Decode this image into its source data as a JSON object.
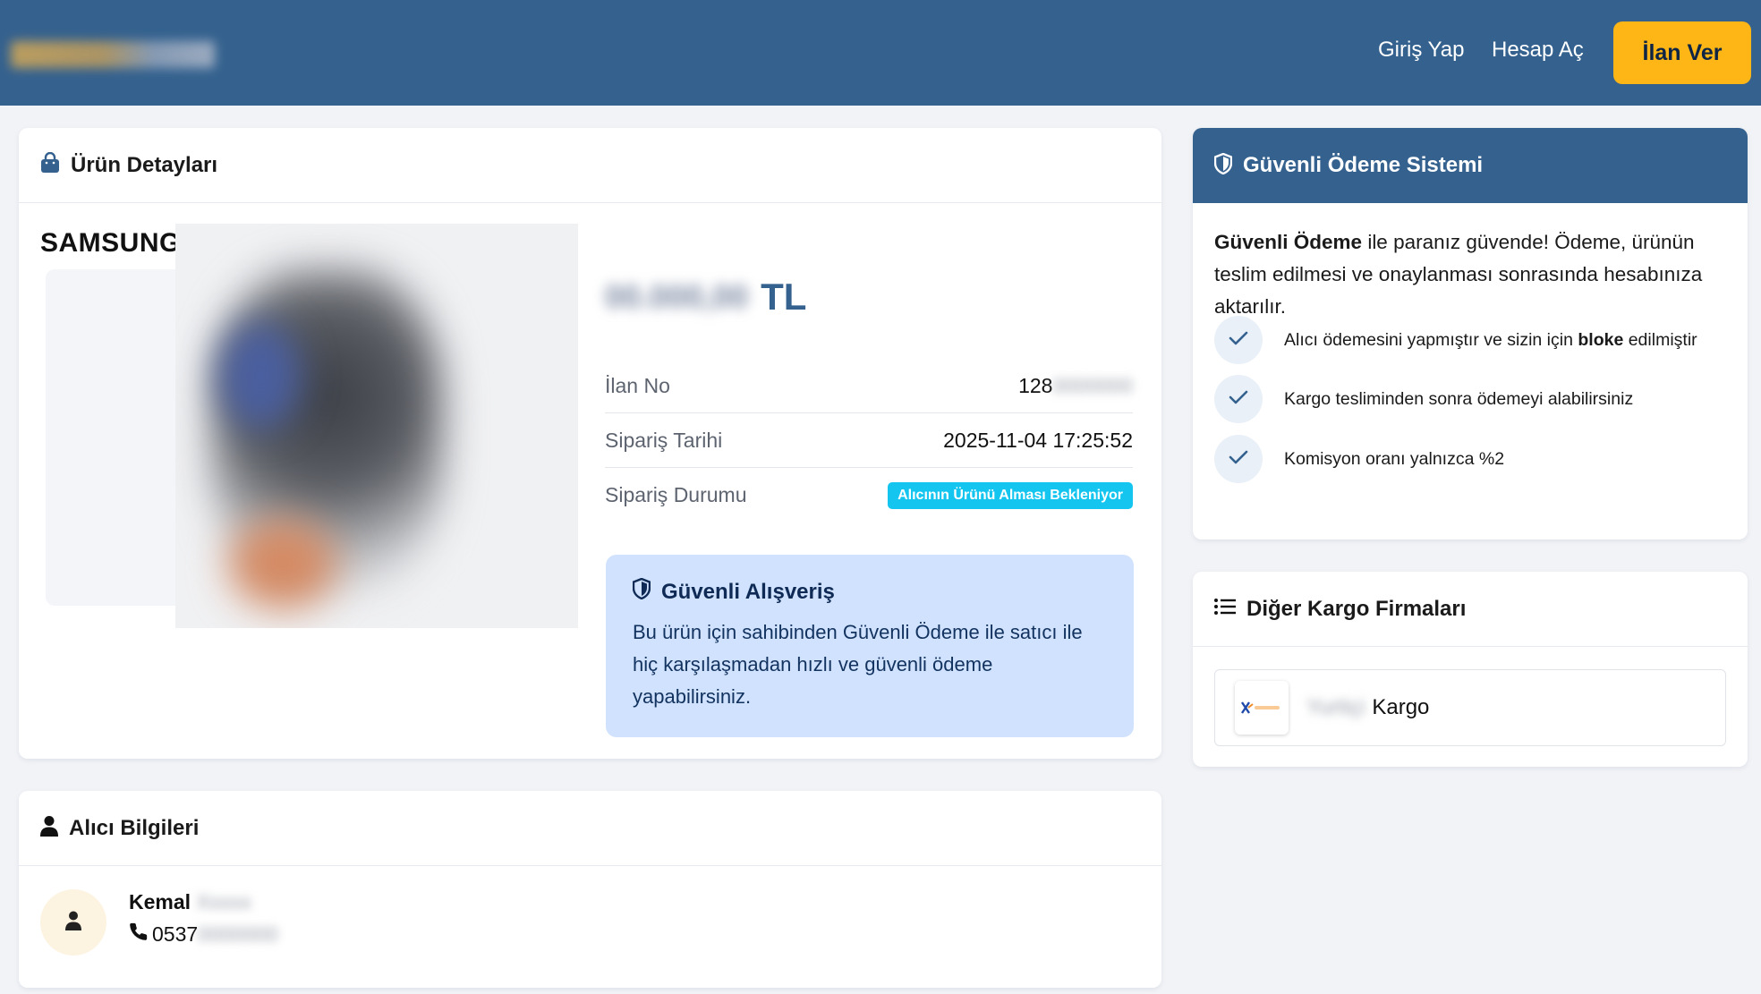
{
  "header": {
    "logo_text": "sahibinden.com",
    "login": "Giriş Yap",
    "register": "Hesap Aç",
    "post_ad": "İlan Ver"
  },
  "product": {
    "title": "Ürün Detayları",
    "brand": "SAMSUNG",
    "price_value": "00.000,00",
    "price_currency": "TL",
    "rows": [
      {
        "label": "İlan No",
        "value": "128",
        "value_hidden": "0000000"
      },
      {
        "label": "Sipariş Tarihi",
        "value": "2025-11-04 17:25:52"
      },
      {
        "label": "Sipariş Durumu",
        "value": "Alıcının Ürünü Alması Bekleniyor"
      }
    ],
    "secure": {
      "title": "Güvenli Alışveriş",
      "text": "Bu ürün için sahibinden Güvenli Ödeme ile satıcı ile hiç karşılaşmadan hızlı ve güvenli ödeme yapabilirsiniz."
    }
  },
  "buyer": {
    "title": "Alıcı Bilgileri",
    "first_name": "Kemal",
    "last_name_hidden": "Xxxxx",
    "phone": "0537",
    "phone_hidden": "0000000"
  },
  "payment": {
    "title": "Güvenli Ödeme Sistemi",
    "intro_bold": "Güvenli Ödeme",
    "intro_rest": " ile paranız güvende! Ödeme, ürünün teslim edilmesi ve onaylanması sonrasında hesabınıza aktarılır.",
    "checks": [
      {
        "pre": "Alıcı ödemesini yapmıştır ve sizin için ",
        "bold": "bloke",
        "post": " edilmiştir"
      },
      {
        "pre": "Kargo tesliminden sonra ödemeyi alabilirsiniz",
        "bold": "",
        "post": ""
      },
      {
        "pre": "Komisyon oranı yalnızca %2",
        "bold": "",
        "post": ""
      }
    ]
  },
  "cargo": {
    "title": "Diğer Kargo Firmaları",
    "item_prefix_hidden": "Yurtiçi",
    "item_name": "Kargo"
  },
  "colors": {
    "header": "#34618e",
    "accent_yellow": "#fdb616",
    "status_badge": "#13c5ef",
    "secure_box": "#d0e2fd"
  }
}
